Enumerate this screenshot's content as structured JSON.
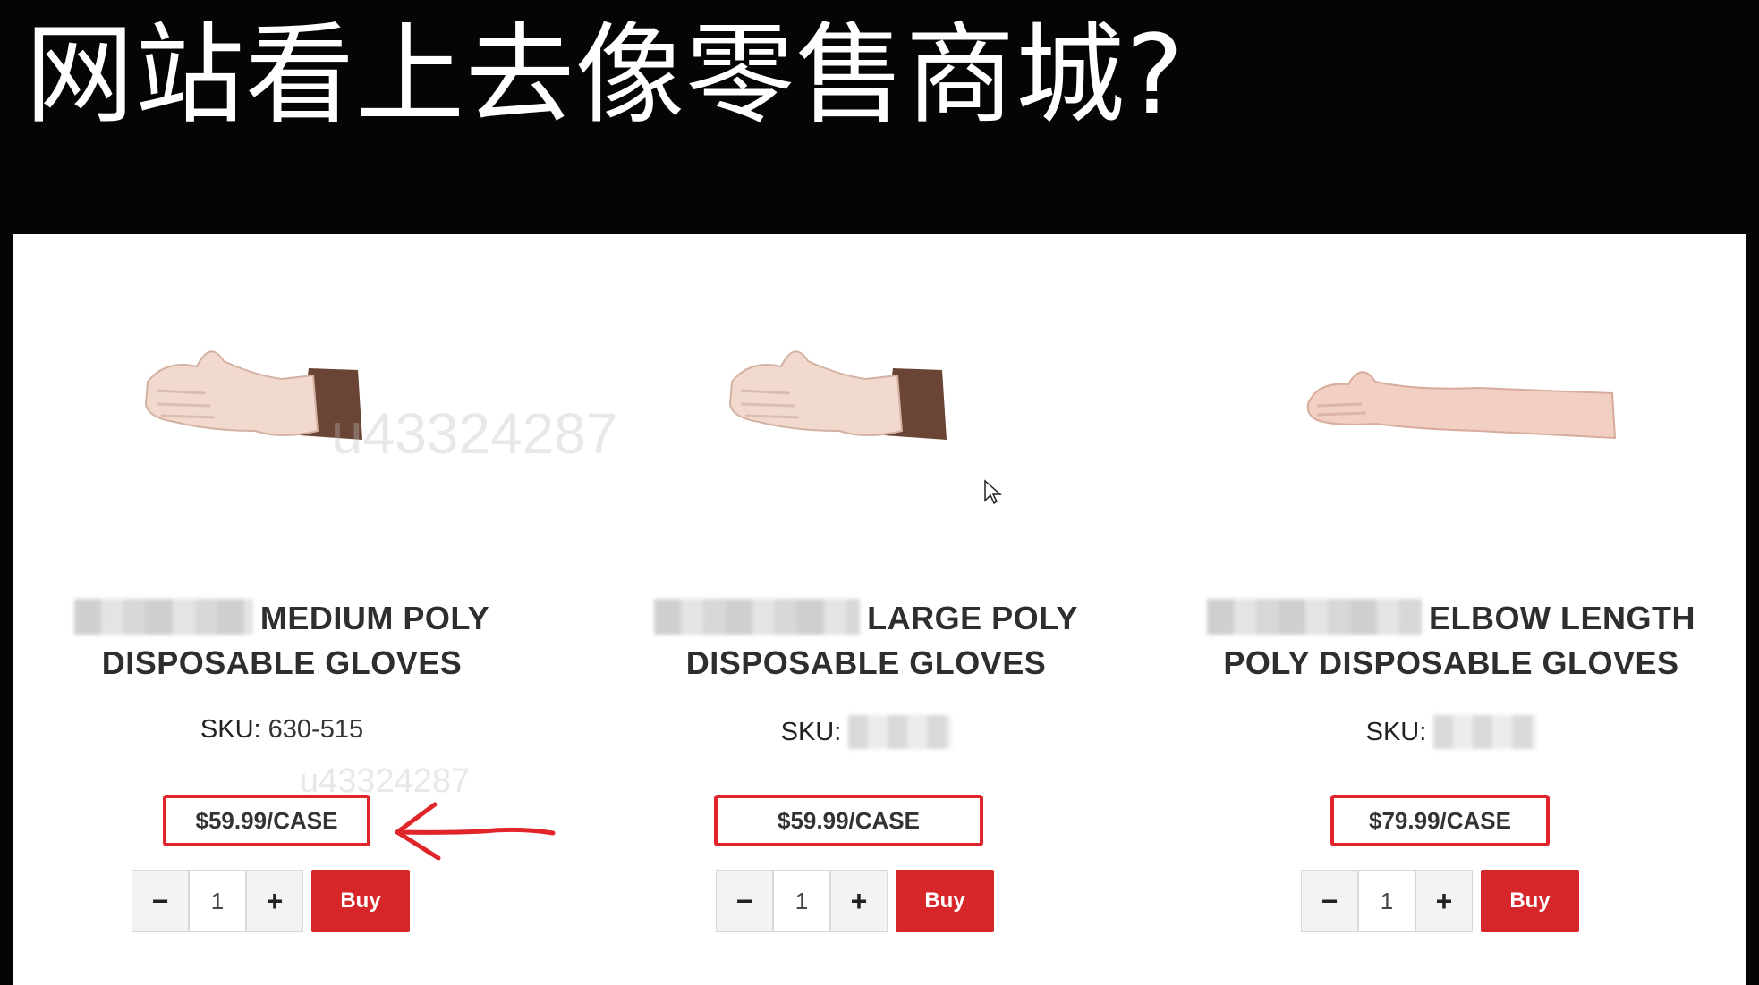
{
  "slide": {
    "title": "网站看上去像零售商城?"
  },
  "watermark": {
    "text_large": "u43324287",
    "text_small": "u43324287"
  },
  "products": [
    {
      "title_line1": "MEDIUM POLY",
      "title_line2": "DISPOSABLE GLOVES",
      "sku_label": "SKU:",
      "sku_value": "630-515",
      "price": "$59.99/CASE",
      "quantity": "1",
      "minus_label": "−",
      "plus_label": "+",
      "buy_label": "Buy"
    },
    {
      "title_line1": "LARGE POLY",
      "title_line2": "DISPOSABLE GLOVES",
      "sku_label": "SKU:",
      "sku_value": "",
      "price": "$59.99/CASE",
      "quantity": "1",
      "minus_label": "−",
      "plus_label": "+",
      "buy_label": "Buy"
    },
    {
      "title_line1": "ELBOW LENGTH",
      "title_line2": "POLY DISPOSABLE GLOVES",
      "sku_label": "SKU:",
      "sku_value": "",
      "price": "$79.99/CASE",
      "quantity": "1",
      "minus_label": "−",
      "plus_label": "+",
      "buy_label": "Buy"
    }
  ],
  "colors": {
    "accent_red": "#d7262a",
    "background": "#050505",
    "panel": "#ffffff"
  },
  "icons": {
    "annotation": "red-arrow-icon",
    "pointer": "mouse-cursor-icon"
  }
}
